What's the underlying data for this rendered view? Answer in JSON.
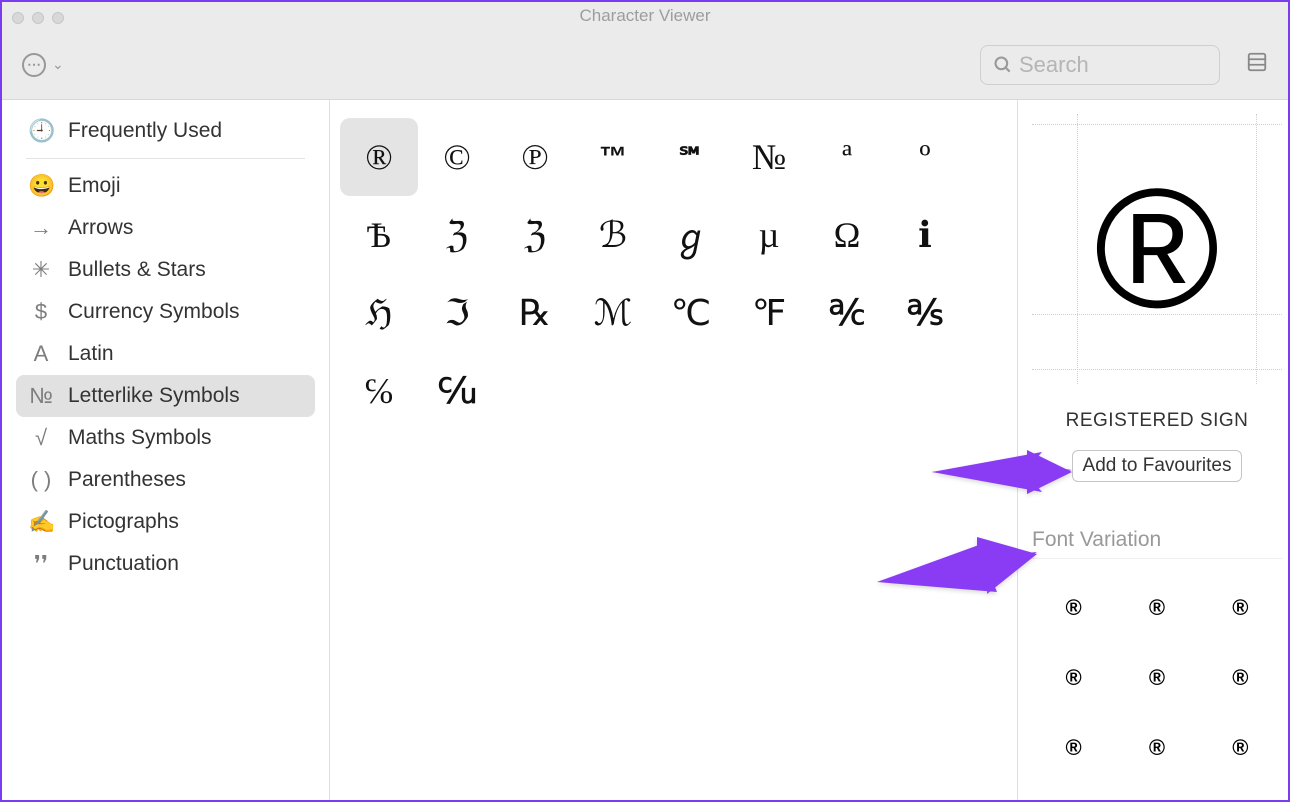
{
  "window": {
    "title": "Character Viewer"
  },
  "toolbar": {
    "search_placeholder": "Search"
  },
  "sidebar": {
    "items": [
      {
        "id": "frequently-used",
        "icon": "🕘",
        "label": "Frequently Used",
        "divider_after": true
      },
      {
        "id": "emoji",
        "icon": "😀",
        "label": "Emoji"
      },
      {
        "id": "arrows",
        "icon": "→",
        "label": "Arrows"
      },
      {
        "id": "bullets-stars",
        "icon": "✳",
        "label": "Bullets & Stars"
      },
      {
        "id": "currency",
        "icon": "$",
        "label": "Currency Symbols"
      },
      {
        "id": "latin",
        "icon": "A",
        "label": "Latin"
      },
      {
        "id": "letterlike",
        "icon": "№",
        "label": "Letterlike Symbols",
        "selected": true
      },
      {
        "id": "maths",
        "icon": "√",
        "label": "Maths Symbols"
      },
      {
        "id": "parentheses",
        "icon": "( )",
        "label": "Parentheses"
      },
      {
        "id": "pictographs",
        "icon": "✍",
        "label": "Pictographs"
      },
      {
        "id": "punctuation",
        "icon": "❜❜",
        "label": "Punctuation"
      }
    ]
  },
  "grid": {
    "characters": [
      {
        "g": "®",
        "selected": true
      },
      {
        "g": "©"
      },
      {
        "g": "℗"
      },
      {
        "g": "™",
        "small": true
      },
      {
        "g": "℠",
        "small": true
      },
      {
        "g": "№"
      },
      {
        "g": "ª"
      },
      {
        "g": "º"
      },
      {
        "g": "Ѣ"
      },
      {
        "g": "ℨ"
      },
      {
        "g": "ℨ"
      },
      {
        "g": "ℬ"
      },
      {
        "g": "ℊ"
      },
      {
        "g": "µ"
      },
      {
        "g": "Ω"
      },
      {
        "g": "ℹ"
      },
      {
        "g": "ℌ"
      },
      {
        "g": "ℑ"
      },
      {
        "g": "℞"
      },
      {
        "g": "ℳ"
      },
      {
        "g": "℃"
      },
      {
        "g": "℉"
      },
      {
        "g": "℀"
      },
      {
        "g": "℁"
      },
      {
        "g": "℅"
      },
      {
        "g": "℆"
      }
    ]
  },
  "detail": {
    "glyph": "®",
    "name": "REGISTERED SIGN",
    "add_fav_label": "Add to Favourites",
    "font_variation_label": "Font Variation",
    "variations": [
      "®",
      "®",
      "®",
      "®",
      "®",
      "®",
      "®",
      "®",
      "®"
    ]
  }
}
